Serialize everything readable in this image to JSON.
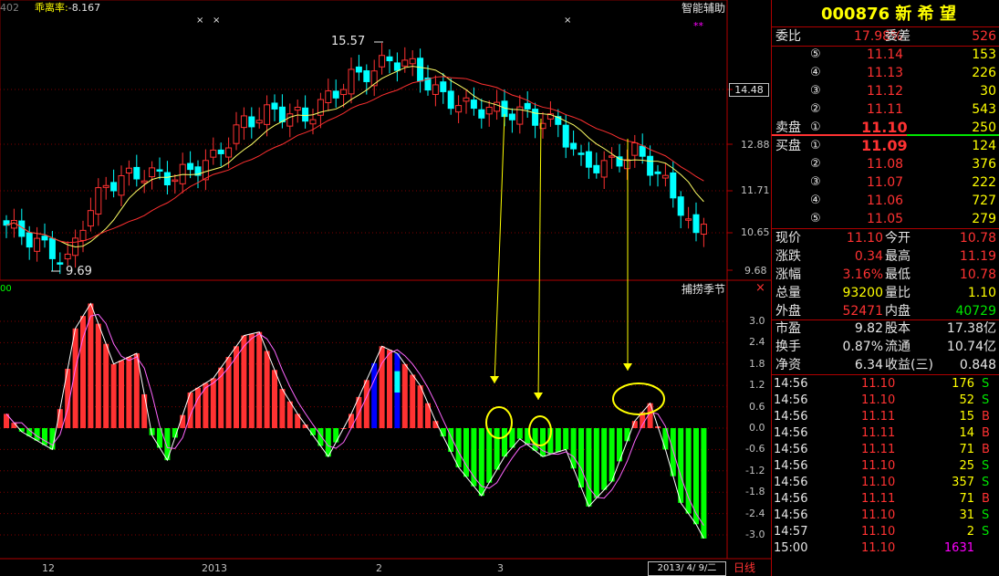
{
  "top_indicator": {
    "code": "402",
    "label": "乖离率:",
    "value": "-8.167"
  },
  "markers": {
    "x1": "×",
    "x2": "×",
    "x3": "×",
    "stars": "**"
  },
  "assist_label": "智能辅助",
  "upper_price_labels": [
    "14.48",
    "12.88",
    "11.71",
    "10.65",
    "9.68"
  ],
  "high_annot": "15.57",
  "low_annot": "9.69",
  "lower_indicator": {
    "title": "捕捞季节",
    "code": "00",
    "close_mark": "×"
  },
  "lower_axis_labels": [
    "3.0",
    "2.4",
    "1.8",
    "1.2",
    "0.6",
    "0.0",
    "-0.6",
    "-1.2",
    "-1.8",
    "-2.4",
    "-3.0"
  ],
  "x_axis_labels": [
    "12",
    "2013",
    "2",
    "3"
  ],
  "status_bar": {
    "date": "2013/ 4/ 9/二",
    "period": "日线"
  },
  "colors": {
    "up": "#ff3232",
    "down": "#00ffff",
    "green_bar": "#00ff00",
    "blue_bar": "#0000ff",
    "ma_short": "#ffff66",
    "ma_long": "#ff3030",
    "grid": "#800000"
  },
  "panel": {
    "title": "000876 新 希 望",
    "weibi": {
      "label": "委比",
      "value": "17.98%",
      "label2": "委差",
      "value2": "526"
    },
    "sell_label": "卖盘",
    "buy_label": "买盘",
    "asks": [
      {
        "level": "⑤",
        "price": "11.14",
        "volume": "153"
      },
      {
        "level": "④",
        "price": "11.13",
        "volume": "226"
      },
      {
        "level": "③",
        "price": "11.12",
        "volume": "30"
      },
      {
        "level": "②",
        "price": "11.11",
        "volume": "543"
      },
      {
        "level": "①",
        "price": "11.10",
        "volume": "250"
      }
    ],
    "bids": [
      {
        "level": "①",
        "price": "11.09",
        "volume": "124"
      },
      {
        "level": "②",
        "price": "11.08",
        "volume": "376"
      },
      {
        "level": "③",
        "price": "11.07",
        "volume": "222"
      },
      {
        "level": "④",
        "price": "11.06",
        "volume": "727"
      },
      {
        "level": "⑤",
        "price": "11.05",
        "volume": "279"
      }
    ],
    "quote": [
      {
        "l1": "现价",
        "v1": "11.10",
        "l2": "今开",
        "v2": "10.78"
      },
      {
        "l1": "涨跌",
        "v1": "0.34",
        "l2": "最高",
        "v2": "11.19"
      },
      {
        "l1": "涨幅",
        "v1": "3.16%",
        "l2": "最低",
        "v2": "10.78"
      },
      {
        "l1": "总量",
        "v1": "93200",
        "l2": "量比",
        "v2": "1.10"
      },
      {
        "l1": "外盘",
        "v1": "52471",
        "l2": "内盘",
        "v2": "40729"
      }
    ],
    "fundamentals": [
      {
        "l1": "市盈",
        "v1": "9.82",
        "l2": "股本",
        "v2": "17.38亿"
      },
      {
        "l1": "换手",
        "v1": "0.87%",
        "l2": "流通",
        "v2": "10.74亿"
      },
      {
        "l1": "净资",
        "v1": "6.34",
        "l2": "收益(三)",
        "v2": "0.848"
      }
    ],
    "ticks": [
      {
        "time": "14:56",
        "price": "11.10",
        "vol": "176",
        "side": "S"
      },
      {
        "time": "14:56",
        "price": "11.10",
        "vol": "52",
        "side": "S"
      },
      {
        "time": "14:56",
        "price": "11.11",
        "vol": "15",
        "side": "B"
      },
      {
        "time": "14:56",
        "price": "11.11",
        "vol": "14",
        "side": "B"
      },
      {
        "time": "14:56",
        "price": "11.11",
        "vol": "71",
        "side": "B"
      },
      {
        "time": "14:56",
        "price": "11.10",
        "vol": "25",
        "side": "S"
      },
      {
        "time": "14:56",
        "price": "11.10",
        "vol": "357",
        "side": "S"
      },
      {
        "time": "14:56",
        "price": "11.11",
        "vol": "71",
        "side": "B"
      },
      {
        "time": "14:56",
        "price": "11.10",
        "vol": "31",
        "side": "S"
      },
      {
        "time": "14:57",
        "price": "11.10",
        "vol": "2",
        "side": "S"
      },
      {
        "time": "15:00",
        "price": "11.10",
        "vol": "1631",
        "side": ""
      }
    ]
  }
}
